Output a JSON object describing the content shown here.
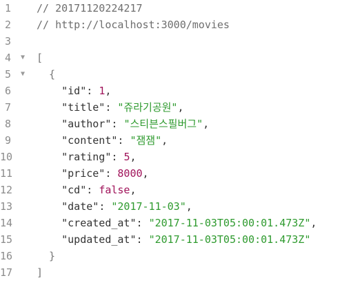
{
  "lines": [
    {
      "n": "1",
      "fold": "",
      "parts": [
        {
          "t": "// 20171120224217",
          "c": "comment"
        }
      ]
    },
    {
      "n": "2",
      "fold": "",
      "parts": [
        {
          "t": "// http://localhost:3000/movies",
          "c": "comment"
        }
      ]
    },
    {
      "n": "3",
      "fold": "",
      "parts": []
    },
    {
      "n": "4",
      "fold": "▼",
      "parts": [
        {
          "t": "[",
          "c": "br"
        }
      ]
    },
    {
      "n": "5",
      "fold": "▼",
      "parts": [
        {
          "t": "  {",
          "c": "br"
        }
      ]
    },
    {
      "n": "6",
      "fold": "",
      "parts": [
        {
          "t": "    \"id\"",
          "c": "key"
        },
        {
          "t": ": ",
          "c": "punc"
        },
        {
          "t": "1",
          "c": "num"
        },
        {
          "t": ",",
          "c": "punc"
        }
      ]
    },
    {
      "n": "7",
      "fold": "",
      "parts": [
        {
          "t": "    \"title\"",
          "c": "key"
        },
        {
          "t": ": ",
          "c": "punc"
        },
        {
          "t": "\"쥬라기공원\"",
          "c": "str"
        },
        {
          "t": ",",
          "c": "punc"
        }
      ]
    },
    {
      "n": "8",
      "fold": "",
      "parts": [
        {
          "t": "    \"author\"",
          "c": "key"
        },
        {
          "t": ": ",
          "c": "punc"
        },
        {
          "t": "\"스티븐스필버그\"",
          "c": "str"
        },
        {
          "t": ",",
          "c": "punc"
        }
      ]
    },
    {
      "n": "9",
      "fold": "",
      "parts": [
        {
          "t": "    \"content\"",
          "c": "key"
        },
        {
          "t": ": ",
          "c": "punc"
        },
        {
          "t": "\"잼잼\"",
          "c": "str"
        },
        {
          "t": ",",
          "c": "punc"
        }
      ]
    },
    {
      "n": "10",
      "fold": "",
      "parts": [
        {
          "t": "    \"rating\"",
          "c": "key"
        },
        {
          "t": ": ",
          "c": "punc"
        },
        {
          "t": "5",
          "c": "num"
        },
        {
          "t": ",",
          "c": "punc"
        }
      ]
    },
    {
      "n": "11",
      "fold": "",
      "parts": [
        {
          "t": "    \"price\"",
          "c": "key"
        },
        {
          "t": ": ",
          "c": "punc"
        },
        {
          "t": "8000",
          "c": "num"
        },
        {
          "t": ",",
          "c": "punc"
        }
      ]
    },
    {
      "n": "12",
      "fold": "",
      "parts": [
        {
          "t": "    \"cd\"",
          "c": "key"
        },
        {
          "t": ": ",
          "c": "punc"
        },
        {
          "t": "false",
          "c": "bool"
        },
        {
          "t": ",",
          "c": "punc"
        }
      ]
    },
    {
      "n": "13",
      "fold": "",
      "parts": [
        {
          "t": "    \"date\"",
          "c": "key"
        },
        {
          "t": ": ",
          "c": "punc"
        },
        {
          "t": "\"2017-11-03\"",
          "c": "str"
        },
        {
          "t": ",",
          "c": "punc"
        }
      ]
    },
    {
      "n": "14",
      "fold": "",
      "parts": [
        {
          "t": "    \"created_at\"",
          "c": "key"
        },
        {
          "t": ": ",
          "c": "punc"
        },
        {
          "t": "\"2017-11-03T05:00:01.473Z\"",
          "c": "str"
        },
        {
          "t": ",",
          "c": "punc"
        }
      ]
    },
    {
      "n": "15",
      "fold": "",
      "parts": [
        {
          "t": "    \"updated_at\"",
          "c": "key"
        },
        {
          "t": ": ",
          "c": "punc"
        },
        {
          "t": "\"2017-11-03T05:00:01.473Z\"",
          "c": "str"
        }
      ]
    },
    {
      "n": "16",
      "fold": "",
      "parts": [
        {
          "t": "  }",
          "c": "br"
        }
      ]
    },
    {
      "n": "17",
      "fold": "",
      "parts": [
        {
          "t": "]",
          "c": "br"
        }
      ]
    }
  ]
}
